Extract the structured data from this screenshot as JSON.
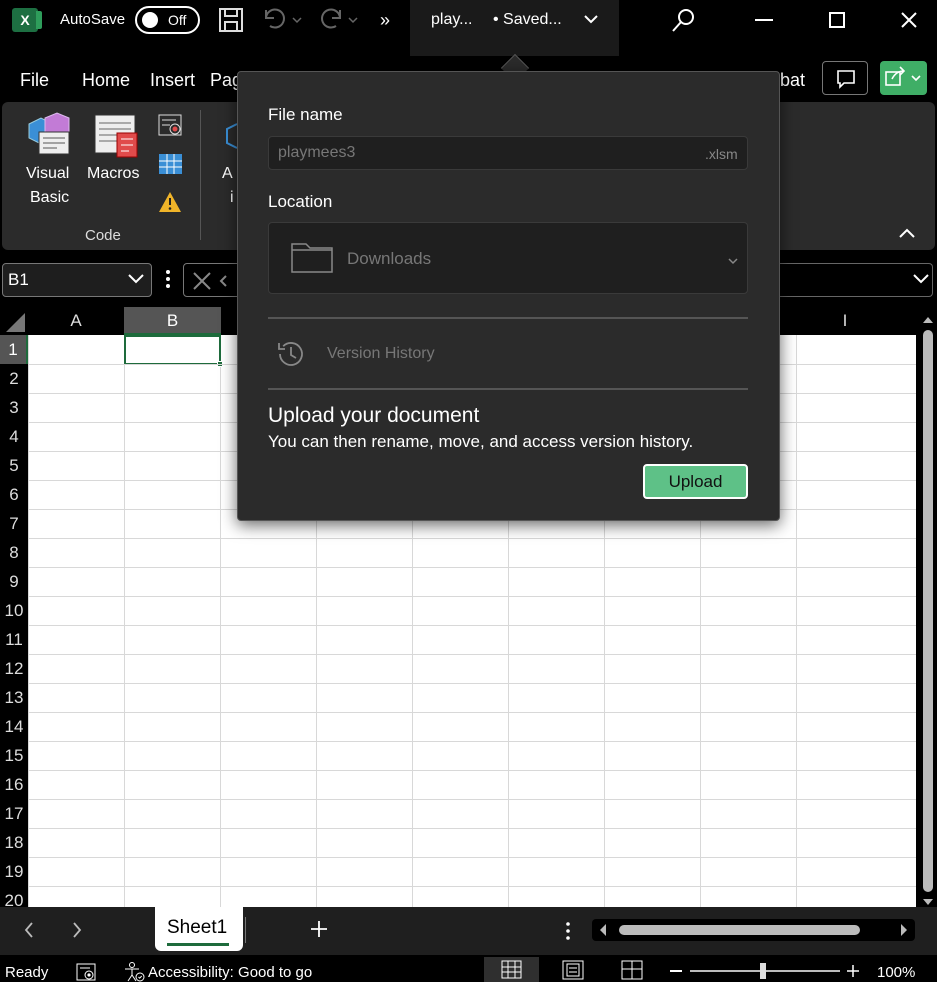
{
  "titlebar": {
    "autosave_label": "AutoSave",
    "toggle_state": "Off",
    "title": "play...",
    "status": "• Saved..."
  },
  "menu": {
    "tabs": [
      "File",
      "Home",
      "Insert",
      "Pag",
      "bat"
    ]
  },
  "ribbon": {
    "visual_basic_line1": "Visual",
    "visual_basic_line2": "Basic",
    "macros": "Macros",
    "partial_line1": "A",
    "partial_line2": "i",
    "group_label": "Code"
  },
  "formula_bar": {
    "namebox": "B1"
  },
  "grid": {
    "columns": [
      "A",
      "B",
      "I"
    ],
    "rows": [
      "1",
      "2",
      "3",
      "4",
      "5",
      "6",
      "7",
      "8",
      "9",
      "10",
      "11",
      "12",
      "13",
      "14",
      "15",
      "16",
      "17",
      "18",
      "19",
      "20"
    ],
    "selected_cell": "B1"
  },
  "sheets": {
    "active": "Sheet1"
  },
  "statusbar": {
    "ready": "Ready",
    "accessibility": "Accessibility: Good to go",
    "zoom": "100%"
  },
  "popup": {
    "file_name_label": "File name",
    "file_name_value": "playmees3",
    "file_ext": ".xlsm",
    "location_label": "Location",
    "location_value": "Downloads",
    "version_history": "Version History",
    "upload_title": "Upload your document",
    "upload_desc": "You can then rename, move, and access version history.",
    "upload_button": "Upload"
  },
  "colors": {
    "accent_green": "#5ec187",
    "excel_green": "#1d6f42",
    "selection_green": "#1e6b3c"
  }
}
